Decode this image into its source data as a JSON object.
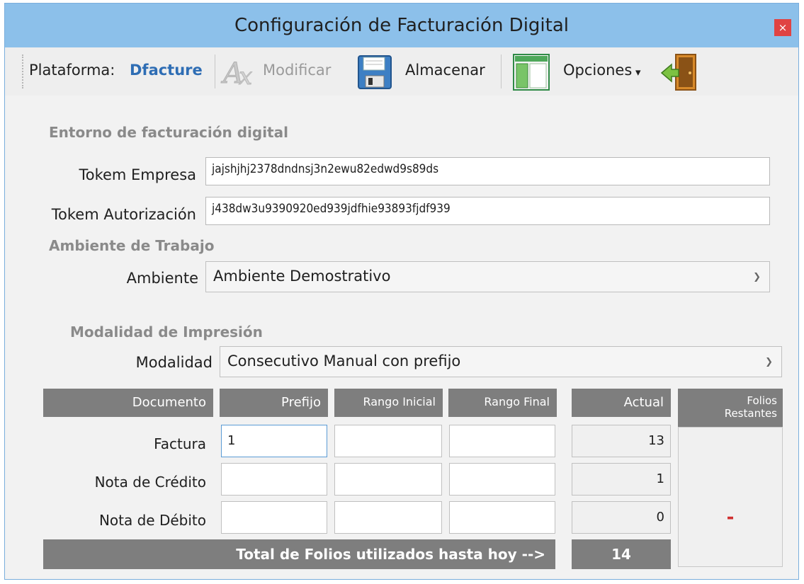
{
  "window": {
    "title": "Configuración de Facturación Digital",
    "close_glyph": "×"
  },
  "toolbar": {
    "platform_label": "Plataforma:",
    "platform_value": "Dfacture",
    "modify_label": "Modificar",
    "save_label": "Almacenar",
    "options_label": "Opciones",
    "options_arrow": "▾",
    "icons": [
      "modify-icon",
      "floppy-disk-icon",
      "window-options-icon",
      "exit-door-icon"
    ]
  },
  "environment": {
    "section_title": "Entorno de facturación digital",
    "token_company_label": "Tokem Empresa",
    "token_company_value": "jajshjhj2378dndnsj3n2ewu82edwd9s89ds",
    "token_auth_label": "Tokem Autorización",
    "token_auth_value": "j438dw3u9390920ed939jdfhie93893fjdf939"
  },
  "work_env": {
    "section_title": "Ambiente de Trabajo",
    "label": "Ambiente",
    "selected": "Ambiente Demostrativo"
  },
  "print_mode": {
    "section_title": "Modalidad de Impresión",
    "label": "Modalidad",
    "selected": "Consecutivo Manual con prefijo"
  },
  "table": {
    "headers": [
      "Documento",
      "Prefijo",
      "Rango Inicial",
      "Rango Final",
      "Actual"
    ],
    "remaining_header": "Folios Restantes",
    "remaining_value": "-",
    "rows": [
      {
        "document": "Factura",
        "prefix": "1",
        "start": "",
        "end": "",
        "current": "13"
      },
      {
        "document": "Nota de Crédito",
        "prefix": "",
        "start": "",
        "end": "",
        "current": "1"
      },
      {
        "document": "Nota de Débito",
        "prefix": "",
        "start": "",
        "end": "",
        "current": "0"
      }
    ],
    "total_label": "Total de Folios utilizados hasta hoy -->",
    "total_value": "14"
  },
  "colors": {
    "titlebar": "#8cc0ea",
    "close": "#e04343",
    "header_gray": "#7e7e7e",
    "platform_blue": "#2e6db4"
  }
}
